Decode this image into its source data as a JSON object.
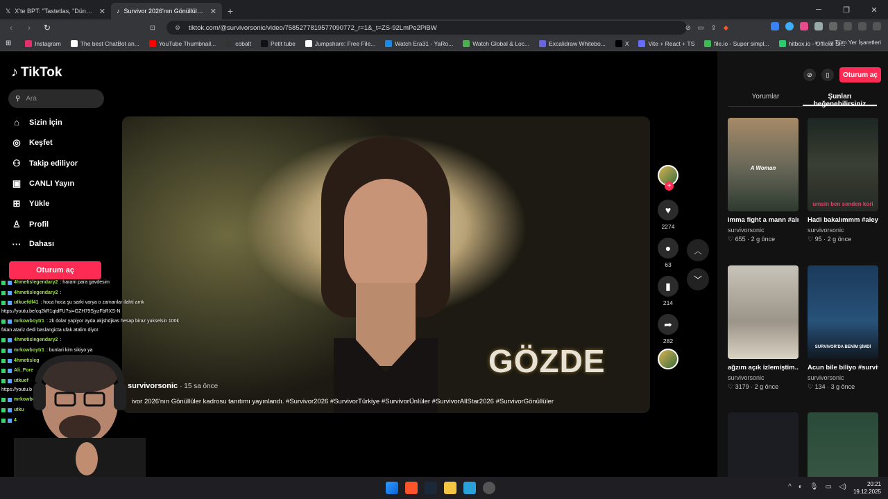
{
  "tabs": [
    {
      "title": "X'te BPT: \"Tastetlas, \"Dünyanın en iyi",
      "icon": "x-logo-icon"
    },
    {
      "title": "Survivor 2026'nın Gönüllüler kad",
      "icon": "tiktok-icon",
      "active": true
    }
  ],
  "address": {
    "url": "tiktok.com/@survivorsonic/video/7585277819577090772_r=1&_t=ZS-92LmPe2PiBW"
  },
  "bookmarks": [
    {
      "label": "Instagram",
      "color": "#e1306c"
    },
    {
      "label": "The best ChatBot an...",
      "color": "#ffffff"
    },
    {
      "label": "YouTube Thumbnail...",
      "color": "#ff0000"
    },
    {
      "label": "cobalt",
      "color": "#333333"
    },
    {
      "label": "Petit tube",
      "color": "#111111"
    },
    {
      "label": "Jumpshare: Free File...",
      "color": "#ffffff"
    },
    {
      "label": "Watch Era31 - YaRo...",
      "color": "#1e88e5"
    },
    {
      "label": "Watch Global & Loc...",
      "color": "#4caf50"
    },
    {
      "label": "Excalidraw Whitebo...",
      "color": "#6965db"
    },
    {
      "label": "X",
      "color": "#000000"
    },
    {
      "label": "Vite + React + TS",
      "color": "#646cff"
    },
    {
      "label": "file.io - Super simpl...",
      "color": "#3cba54"
    },
    {
      "label": "hitbox.io - Official Si...",
      "color": "#2ecc71"
    }
  ],
  "bookmarks_right": {
    "more": "»",
    "all": "Tüm Yer İşaretleri"
  },
  "sidebar": {
    "logo": "TikTok",
    "search_placeholder": "Ara",
    "items": [
      {
        "label": "Sizin İçin",
        "icon": "home-icon"
      },
      {
        "label": "Keşfet",
        "icon": "compass-icon"
      },
      {
        "label": "Takip ediliyor",
        "icon": "following-icon"
      },
      {
        "label": "CANLI Yayın",
        "icon": "live-icon"
      },
      {
        "label": "Yükle",
        "icon": "upload-icon"
      },
      {
        "label": "Profil",
        "icon": "profile-icon"
      },
      {
        "label": "Dahası",
        "icon": "more-icon"
      }
    ],
    "login": "Oturum aç"
  },
  "video": {
    "overlay_name": "GÖZDE",
    "author": "survivorsonic",
    "time": "· 15 sa önce",
    "caption": "ivor 2026'nın Gönüllüler kadrosu tanıtımı yayınlandı. #Survivor2026 #SurvivorTürkiye #SurvivorÜnlüler #SurvivorAllStar2026 #SurvivorGönüllüler"
  },
  "actions": {
    "likes": "2274",
    "comments": "63",
    "saves": "214",
    "shares": "282"
  },
  "right_panel": {
    "login": "Oturum aç",
    "tabs": [
      "Yorumlar",
      "Şunları beğenebilirsiniz"
    ],
    "cards": [
      {
        "title": "imma fight a mann #almeda #adilha...",
        "author": "survivorsonic",
        "likes": "655",
        "age": "2 g önce",
        "overlay": "A Woman"
      },
      {
        "title": "Hadi bakalımmm #aleynakalaycio...",
        "author": "survivorsonic",
        "likes": "95",
        "age": "2 g önce",
        "overlay": "umsin ben senden kori"
      },
      {
        "title": "ağzım açık izlemiştim...",
        "author": "survivorsonic",
        "likes": "3179",
        "age": "2 g önce",
        "overlay": ""
      },
      {
        "title": "Acun bile biliyo #survivortürkiye...",
        "author": "survivorsonic",
        "likes": "134",
        "age": "3 g önce",
        "overlay": "SURVIVOR'DA BENİM ŞİMDİ"
      }
    ]
  },
  "chat": [
    {
      "user": "4hmetislegendary2",
      "text": ": haram para gavdesim"
    },
    {
      "user": "4hmetislegendary2",
      "text": ":"
    },
    {
      "user": "utkuefdf41",
      "text": ": hoca hoca şu sarki varya o zamanlar ilahti amk"
    },
    {
      "user": "",
      "text": "https://youtu.be/cq2kR1qtdFU?si=GZH79SjyzFbRXS-N"
    },
    {
      "user": "mrkowboytr1",
      "text": ": 2k dolar yapiyor ayda akjshdjkas hesap biraz yukselsin 100k"
    },
    {
      "user": "",
      "text": "falan atariz dedi baslangicta ufak atalim diyor"
    },
    {
      "user": "4hmetislegendary2",
      "text": ":"
    },
    {
      "user": "mrkowboytr1",
      "text": ": bunlari kim sikiyo ya"
    },
    {
      "user": "4hmetisleg",
      "text": ""
    },
    {
      "user": "Ali_Fore",
      "text": ""
    },
    {
      "user": "utkuef",
      "text": ""
    },
    {
      "user": "",
      "text": "https://youtu.b"
    },
    {
      "user": "mrkowboyt",
      "text": ""
    },
    {
      "user": "utku",
      "text": ""
    },
    {
      "user": "4",
      "text": ""
    }
  ],
  "taskbar": {
    "time": "20:21",
    "date": "19.12.2025"
  }
}
